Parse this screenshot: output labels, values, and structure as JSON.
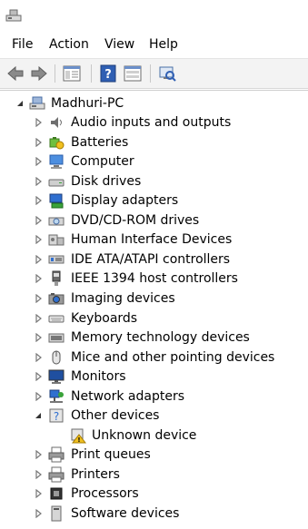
{
  "menu": [
    "File",
    "Action",
    "View",
    "Help"
  ],
  "toolbar": {
    "buttons": [
      "back-arrow-icon",
      "forward-arrow-icon",
      "show-hide-console-tree-icon",
      "help-icon",
      "properties-pane-icon",
      "scan-hardware-icon"
    ]
  },
  "tree": {
    "root": "Madhuri-PC",
    "items": [
      {
        "label": "Audio inputs and outputs",
        "icon": "speaker-icon"
      },
      {
        "label": "Batteries",
        "icon": "battery-icon"
      },
      {
        "label": "Computer",
        "icon": "computer-icon"
      },
      {
        "label": "Disk drives",
        "icon": "disk-drive-icon"
      },
      {
        "label": "Display adapters",
        "icon": "display-adapter-icon"
      },
      {
        "label": "DVD/CD-ROM drives",
        "icon": "dvd-drive-icon"
      },
      {
        "label": "Human Interface Devices",
        "icon": "hid-icon"
      },
      {
        "label": "IDE ATA/ATAPI controllers",
        "icon": "ide-controller-icon"
      },
      {
        "label": "IEEE 1394 host controllers",
        "icon": "firewire-icon"
      },
      {
        "label": "Imaging devices",
        "icon": "camera-icon"
      },
      {
        "label": "Keyboards",
        "icon": "keyboard-icon"
      },
      {
        "label": "Memory technology devices",
        "icon": "memory-card-icon"
      },
      {
        "label": "Mice and other pointing devices",
        "icon": "mouse-icon"
      },
      {
        "label": "Monitors",
        "icon": "monitor-icon"
      },
      {
        "label": "Network adapters",
        "icon": "network-icon"
      },
      {
        "label": "Other devices",
        "icon": "unknown-device-icon"
      },
      {
        "label": "Print queues",
        "icon": "printer-icon"
      },
      {
        "label": "Printers",
        "icon": "printer-icon"
      },
      {
        "label": "Processors",
        "icon": "processor-icon"
      },
      {
        "label": "Software devices",
        "icon": "software-device-icon"
      }
    ],
    "other_devices_child": {
      "label": "Unknown device",
      "icon": "warning-device-icon"
    }
  }
}
